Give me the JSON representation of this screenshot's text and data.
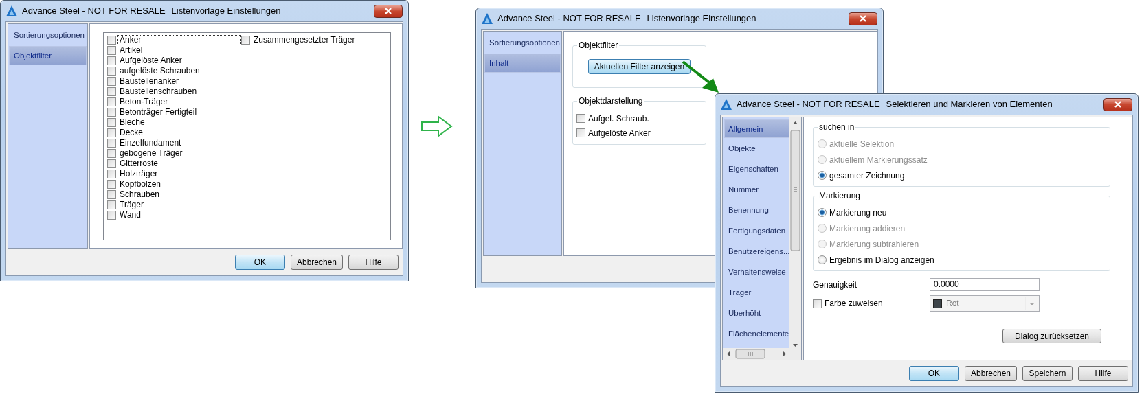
{
  "windows": [
    {
      "app": "Advance Steel - NOT FOR RESALE",
      "title": "Listenvorlage Einstellungen",
      "nav": [
        {
          "label": "Sortierungsoptionen",
          "selected": false
        },
        {
          "label": "Objektfilter",
          "selected": true
        }
      ],
      "checklist": {
        "columns": [
          [
            {
              "label": "Anker",
              "checked": false,
              "focused": true
            },
            {
              "label": "Artikel",
              "checked": false,
              "focused": false
            },
            {
              "label": "Aufgelöste Anker",
              "checked": false,
              "focused": false
            },
            {
              "label": "aufgelöste Schrauben",
              "checked": false,
              "focused": false
            },
            {
              "label": "Baustellenanker",
              "checked": false,
              "focused": false
            },
            {
              "label": "Baustellenschrauben",
              "checked": false,
              "focused": false
            },
            {
              "label": "Beton-Träger",
              "checked": false,
              "focused": false
            },
            {
              "label": "Betonträger Fertigteil",
              "checked": false,
              "focused": false
            },
            {
              "label": "Bleche",
              "checked": false,
              "focused": false
            },
            {
              "label": "Decke",
              "checked": false,
              "focused": false
            },
            {
              "label": "Einzelfundament",
              "checked": false,
              "focused": false
            },
            {
              "label": "gebogene Träger",
              "checked": false,
              "focused": false
            },
            {
              "label": "Gitterroste",
              "checked": false,
              "focused": false
            },
            {
              "label": "Holzträger",
              "checked": false,
              "focused": false
            },
            {
              "label": "Kopfbolzen",
              "checked": false,
              "focused": false
            },
            {
              "label": "Schrauben",
              "checked": false,
              "focused": false
            },
            {
              "label": "Träger",
              "checked": false,
              "focused": false
            },
            {
              "label": "Wand",
              "checked": false,
              "focused": false
            }
          ],
          [
            {
              "label": "Zusammengesetzter Träger",
              "checked": false,
              "focused": false
            }
          ]
        ]
      },
      "buttons": [
        {
          "label": "OK",
          "default": true
        },
        {
          "label": "Abbrechen",
          "default": false
        },
        {
          "label": "Hilfe",
          "default": false
        }
      ]
    },
    {
      "app": "Advance Steel - NOT FOR RESALE",
      "title": "Listenvorlage Einstellungen",
      "nav": [
        {
          "label": "Sortierungsoptionen",
          "selected": false
        },
        {
          "label": "Inhalt",
          "selected": true
        }
      ],
      "groups": [
        {
          "title": "Objektfilter",
          "controls": [
            {
              "kind": "button",
              "label": "Aktuellen Filter anzeigen",
              "default": true
            }
          ]
        },
        {
          "title": "Objektdarstellung",
          "controls": [
            {
              "kind": "checkbox",
              "label": "Aufgel. Schraub.",
              "checked": false
            },
            {
              "kind": "checkbox",
              "label": "Aufgelöste Anker",
              "checked": false
            }
          ]
        }
      ]
    },
    {
      "app": "Advance Steel - NOT FOR RESALE",
      "title": "Selektieren und Markieren von Elementen",
      "nav": [
        {
          "label": "Allgemein",
          "selected": true
        },
        {
          "label": "Objekte",
          "selected": false
        },
        {
          "label": "Eigenschaften",
          "selected": false
        },
        {
          "label": "Nummer",
          "selected": false
        },
        {
          "label": "Benennung",
          "selected": false
        },
        {
          "label": "Fertigungsdaten",
          "selected": false
        },
        {
          "label": "Benutzereigens...",
          "selected": false
        },
        {
          "label": "Verhaltensweise",
          "selected": false
        },
        {
          "label": "Träger",
          "selected": false
        },
        {
          "label": "Überhöht",
          "selected": false
        },
        {
          "label": "Flächenelemente",
          "selected": false
        }
      ],
      "groups": [
        {
          "title": "suchen in",
          "controls": [
            {
              "kind": "radio",
              "label": "aktuelle Selektion",
              "selected": false,
              "disabled": true
            },
            {
              "kind": "radio",
              "label": "aktuellem Markierungssatz",
              "selected": false,
              "disabled": true
            },
            {
              "kind": "radio",
              "label": "gesamter Zeichnung",
              "selected": true,
              "disabled": false
            }
          ]
        },
        {
          "title": "Markierung",
          "controls": [
            {
              "kind": "radio",
              "label": "Markierung neu",
              "selected": true,
              "disabled": false
            },
            {
              "kind": "radio",
              "label": "Markierung addieren",
              "selected": false,
              "disabled": true
            },
            {
              "kind": "radio",
              "label": "Markierung subtrahieren",
              "selected": false,
              "disabled": true
            },
            {
              "kind": "radio",
              "label": "Ergebnis im Dialog anzeigen",
              "selected": false,
              "disabled": false
            }
          ]
        }
      ],
      "fields": [
        {
          "kind": "text",
          "label": "Genauigkeit",
          "value": "0.0000"
        },
        {
          "kind": "color-select",
          "label": "Farbe zuweisen",
          "checked": false,
          "value": "Rot",
          "color": "#3d4449",
          "disabled": true
        }
      ],
      "reset_button": "Dialog zurücksetzen",
      "buttons": [
        {
          "label": "OK",
          "default": true
        },
        {
          "label": "Abbrechen",
          "default": false
        },
        {
          "label": "Speichern",
          "default": false
        },
        {
          "label": "Hilfe",
          "default": false
        }
      ]
    }
  ]
}
